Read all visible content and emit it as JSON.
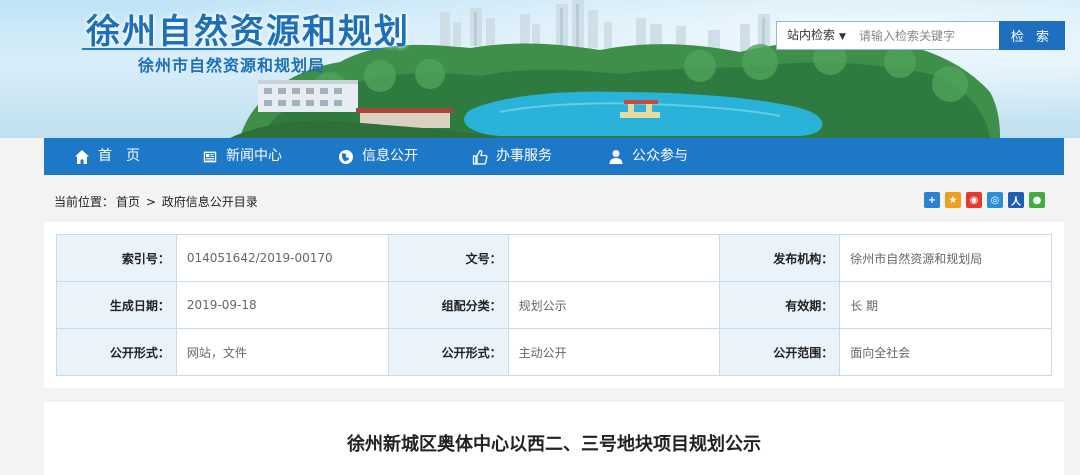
{
  "header": {
    "site_title": "徐州自然资源和规划",
    "site_subtitle": "徐州市自然资源和规划局"
  },
  "search": {
    "scope_label": "站内检索",
    "placeholder": "请输入检索关键字",
    "button_label": "检 索"
  },
  "nav": {
    "items": [
      {
        "label": "首　页",
        "icon": "home-icon"
      },
      {
        "label": "新闻中心",
        "icon": "newspaper-icon"
      },
      {
        "label": "信息公开",
        "icon": "globe-icon"
      },
      {
        "label": "办事服务",
        "icon": "thumbs-up-icon"
      },
      {
        "label": "公众参与",
        "icon": "user-icon"
      }
    ]
  },
  "breadcrumb": {
    "prefix": "当前位置：",
    "home": "首页",
    "sep": ">",
    "current": "政府信息公开目录"
  },
  "meta": {
    "rows": [
      [
        {
          "label": "索引号：",
          "value": "014051642/2019-00170"
        },
        {
          "label": "文号：",
          "value": ""
        },
        {
          "label": "发布机构：",
          "value": "徐州市自然资源和规划局"
        }
      ],
      [
        {
          "label": "生成日期：",
          "value": "2019-09-18"
        },
        {
          "label": "组配分类：",
          "value": "规划公示"
        },
        {
          "label": "有效期：",
          "value": "长 期"
        }
      ],
      [
        {
          "label": "公开形式：",
          "value": "网站，文件"
        },
        {
          "label": "公开形式：",
          "value": "主动公开"
        },
        {
          "label": "公开范围：",
          "value": "面向全社会"
        }
      ]
    ]
  },
  "article": {
    "title": "徐州新城区奥体中心以西二、三号地块项目规划公示"
  },
  "colors": {
    "nav_bg": "#1e78c8",
    "title_blue": "#1d6fb8",
    "label_bg": "#eaf3fa"
  }
}
